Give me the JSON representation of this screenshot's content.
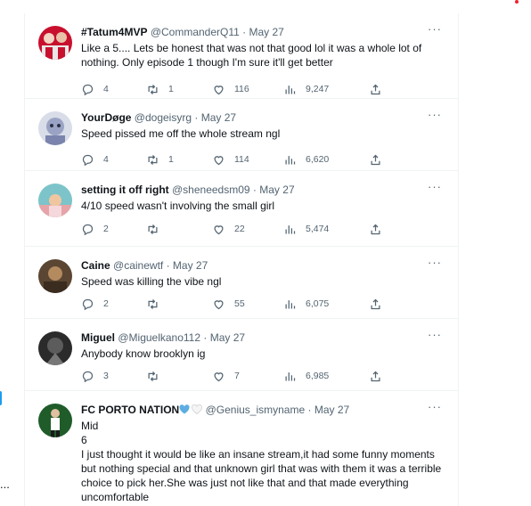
{
  "tweets": [
    {
      "name": "#Tatum4MVP",
      "handle": "@CommanderQ11",
      "sep": "·",
      "date": "May 27",
      "text": "Like a 5.... Lets be honest that was not that good lol it was a whole lot of nothing. Only episode 1 though I'm sure it'll get better",
      "replies": "4",
      "retweets": "1",
      "likes": "116",
      "views": "9,247",
      "more": "···"
    },
    {
      "name": "YourDøge",
      "handle": "@dogeisyrg",
      "sep": "·",
      "date": "May 27",
      "text": "Speed pissed me off the whole stream ngl",
      "replies": "4",
      "retweets": "1",
      "likes": "114",
      "views": "6,620",
      "more": "···"
    },
    {
      "name": "setting it off right",
      "handle": "@sheneedsm09",
      "sep": "·",
      "date": "May 27",
      "text": "4/10 speed wasn't involving the small girl",
      "replies": "2",
      "retweets": "",
      "likes": "22",
      "views": "5,474",
      "more": "···"
    },
    {
      "name": "Caine",
      "handle": "@cainewtf",
      "sep": "·",
      "date": "May 27",
      "text": "Speed was killing the vibe ngl",
      "replies": "2",
      "retweets": "",
      "likes": "55",
      "views": "6,075",
      "more": "···"
    },
    {
      "name": "Miguel",
      "handle": "@Miguelkano112",
      "sep": "·",
      "date": "May 27",
      "text": "Anybody know brooklyn ig",
      "replies": "3",
      "retweets": "",
      "likes": "7",
      "views": "6,985",
      "more": "···"
    },
    {
      "name": "FC PORTO NATION",
      "handle": "@Genius_ismyname",
      "sep": "·",
      "date": "May 27",
      "text": "Mid\n6\nI just thought it would be like an insane stream,it had some funny moments but nothing special and that unknown girl that was with them it was a terrible choice to pick her.She was just not like that and that made everything uncomfortable",
      "more": "···"
    }
  ],
  "left_edge_more": "...",
  "colors": {
    "accent": "#1d9bf0",
    "text": "#0f1419",
    "muted": "#536471",
    "divider": "#eff3f4"
  },
  "icons": [
    "reply-icon",
    "retweet-icon",
    "like-icon",
    "views-icon",
    "share-icon",
    "more-icon",
    "blue-heart-emoji",
    "white-heart-emoji"
  ]
}
